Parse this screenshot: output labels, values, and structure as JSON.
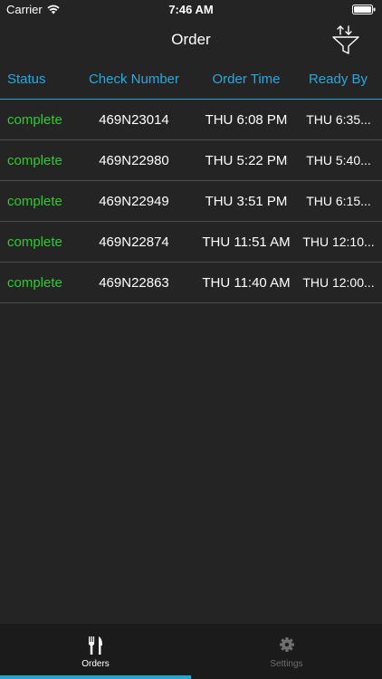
{
  "status_bar": {
    "carrier": "Carrier",
    "time": "7:46 AM",
    "wifi_icon": "wifi-icon",
    "battery_icon": "battery-full-icon"
  },
  "nav": {
    "title": "Order",
    "filter_icon": "sort-filter-funnel-icon"
  },
  "table": {
    "columns": [
      "Status",
      "Check Number",
      "Order Time",
      "Ready By"
    ],
    "rows": [
      {
        "status": "complete",
        "check_number": "469N23014",
        "order_time": "THU 6:08 PM",
        "ready_by": "THU 6:35..."
      },
      {
        "status": "complete",
        "check_number": "469N22980",
        "order_time": "THU 5:22 PM",
        "ready_by": "THU 5:40..."
      },
      {
        "status": "complete",
        "check_number": "469N22949",
        "order_time": "THU 3:51 PM",
        "ready_by": "THU 6:15..."
      },
      {
        "status": "complete",
        "check_number": "469N22874",
        "order_time": "THU 11:51 AM",
        "ready_by": "THU 12:10..."
      },
      {
        "status": "complete",
        "check_number": "469N22863",
        "order_time": "THU 11:40 AM",
        "ready_by": "THU 12:00..."
      }
    ]
  },
  "tabs": [
    {
      "label": "Orders",
      "icon": "fork-knife-icon",
      "active": true
    },
    {
      "label": "Settings",
      "icon": "gear-icon",
      "active": false
    }
  ],
  "colors": {
    "background": "#242424",
    "accent": "#23a6d5",
    "status_complete": "#31c831",
    "tab_bar": "#1b1b1b"
  }
}
